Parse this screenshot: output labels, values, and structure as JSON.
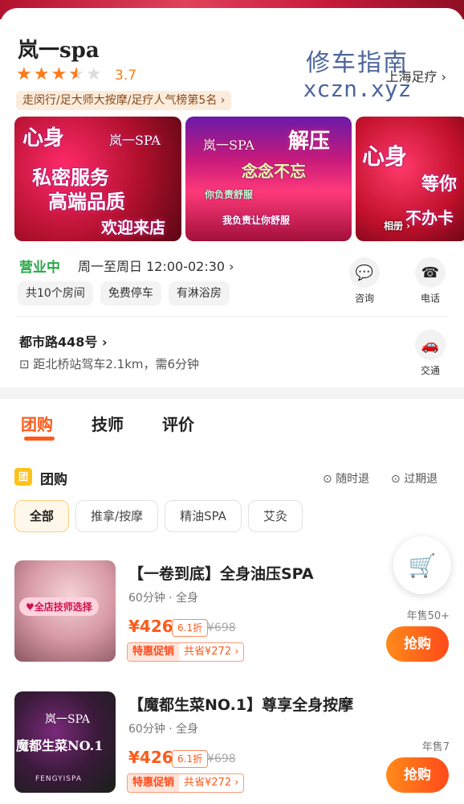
{
  "shop": {
    "name": "岚一spa",
    "rating": "3.7",
    "rank_tag": "走闵行/足大师大按摩/足疗人气榜第5名",
    "top_link": "上海足疗",
    "watermark_line1": "修车指南",
    "watermark_line2": "xczn.xyz"
  },
  "gallery": {
    "img1_line1": "心身",
    "img1_brand": "岚一SPA",
    "img1_line2": "私密服务",
    "img1_line3": "高端品质",
    "img1_line4": "欢迎来店",
    "img2_brand": "岚一SPA",
    "img2_line1": "解压",
    "img2_line2": "念念不忘",
    "img2_line3": "你负责舒服",
    "img2_line4": "我负责让你舒服",
    "img3_line1": "心身",
    "img3_line2": "等你",
    "img3_line3": "不办卡",
    "album_label": "相册 ›"
  },
  "info": {
    "status": "营业中",
    "hours": "周一至周日 12:00-02:30 ›",
    "tags": [
      "共10个房间",
      "免费停车",
      "有淋浴房"
    ],
    "consult_label": "咨询",
    "phone_label": "电话",
    "address": "都市路448号 ›",
    "distance": "距北桥站驾车2.1km，需6分钟",
    "transit_label": "交通"
  },
  "tabs": [
    "团购",
    "技师",
    "评价"
  ],
  "section": {
    "badge": "团",
    "title": "团购",
    "refund1": "随时退",
    "refund2": "过期退"
  },
  "filters": [
    "全部",
    "推拿/按摩",
    "精油SPA",
    "艾灸"
  ],
  "deals": [
    {
      "title": "【一卷到底】全身油压SPA",
      "meta": "60分钟 · 全身",
      "price": "¥426",
      "discount": "6.1折",
      "original": "¥698",
      "promo_label": "特惠促销",
      "save": "共省¥272 ›",
      "sold": "年售50+",
      "buy": "抢购",
      "badge": "♥全店技师选择"
    },
    {
      "title": "【魔都生菜NO.1】尊享全身按摩",
      "meta": "60分钟 · 全身",
      "price": "¥426",
      "discount": "6.1折",
      "original": "¥698",
      "promo_label": "特惠促销",
      "save": "共省¥272 ›",
      "sold": "年售7",
      "buy": "抢购",
      "img_brand": "岚一SPA",
      "img_title": "魔都生菜NO.1",
      "img_footer": "FENGYISPA"
    }
  ],
  "colors": {
    "accent": "#ff5a1a",
    "open_green": "#2aa84a",
    "star": "#ff7a1a"
  }
}
